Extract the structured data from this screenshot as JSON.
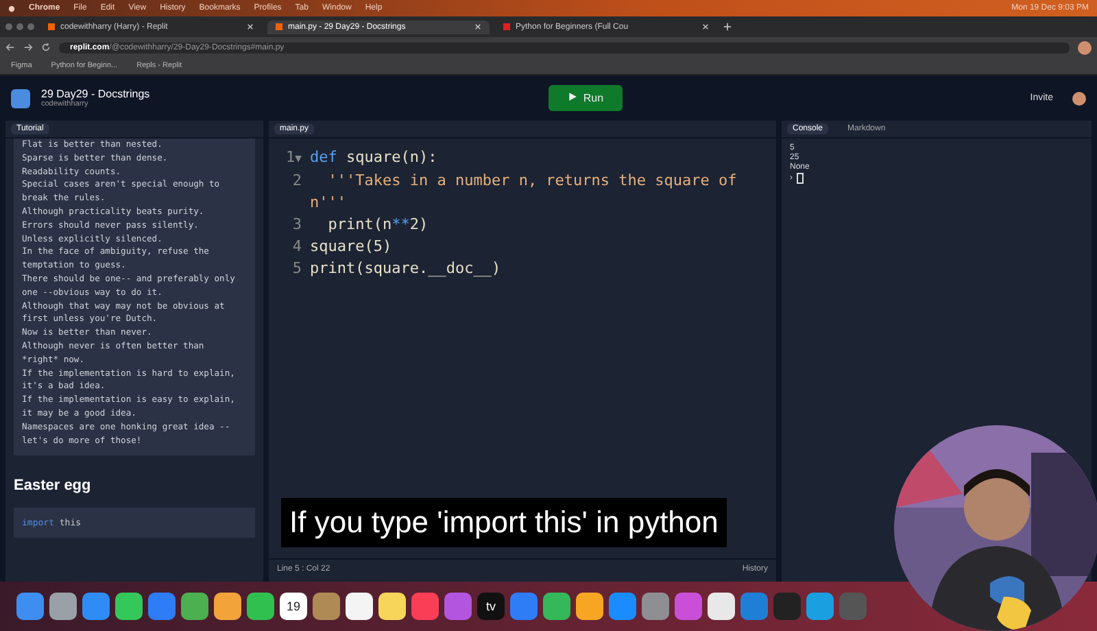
{
  "menu_bar": {
    "items": [
      "Chrome",
      "File",
      "Edit",
      "View",
      "History",
      "Bookmarks",
      "Profiles",
      "Tab",
      "Window",
      "Help"
    ],
    "clock": "Mon 19 Dec 9:03 PM"
  },
  "browser_tabs": [
    {
      "label": "codewithharry (Harry) - Replit",
      "selected": false
    },
    {
      "label": "main.py - 29 Day29 - Docstrings",
      "selected": true
    },
    {
      "label": "Python for Beginners (Full Cou",
      "selected": false
    }
  ],
  "address_bar": {
    "host": "replit.com",
    "path": "/@codewithharry/29-Day29-Docstrings#main.py"
  },
  "bookmarks": [
    "Figma",
    "Python for Beginn...",
    "Repls - Replit"
  ],
  "repl": {
    "title": "29 Day29 - Docstrings",
    "owner": "codewithharry",
    "run_label": "Run",
    "invite_label": "Invite"
  },
  "tutorial": {
    "tab": "Tutorial",
    "lines": [
      "Flat is better than nested.",
      "Sparse is better than dense.",
      "Readability counts.",
      "Special cases aren't special enough to",
      "break the rules.",
      "Although practicality beats purity.",
      "Errors should never pass silently.",
      "Unless explicitly silenced.",
      "In the face of ambiguity, refuse the",
      "temptation to guess.",
      "There should be one-- and preferably only",
      "one --obvious way to do it.",
      "Although that way may not be obvious at",
      "first unless you're Dutch.",
      "Now is better than never.",
      "Although never is often better than",
      "*right* now.",
      "If the implementation is hard to explain,",
      "it's a bad idea.",
      "If the implementation is easy to explain,",
      "it may be a good idea.",
      "Namespaces are one honking great idea --",
      "let's do more of those!"
    ],
    "heading": "Easter egg",
    "code_keyword": "import",
    "code_rest": " this"
  },
  "editor": {
    "tab": "main.py",
    "lines": [
      {
        "number": "1",
        "fold": "▼",
        "parts": [
          {
            "kind": "keyword",
            "text": "def "
          },
          {
            "kind": "name",
            "text": "square(n):"
          }
        ]
      },
      {
        "number": "2",
        "parts": [
          {
            "kind": "string",
            "text": "  '''Takes in a number n, returns the square of"
          }
        ]
      },
      {
        "parts": [
          {
            "kind": "string",
            "text": "n'''"
          }
        ]
      },
      {
        "number": "3",
        "parts": [
          {
            "kind": "name",
            "text": "  print(n"
          },
          {
            "kind": "keyword",
            "text": "**"
          },
          {
            "kind": "name",
            "text": "2)"
          }
        ]
      },
      {
        "number": "4",
        "parts": [
          {
            "kind": "name",
            "text": "square(5)"
          }
        ]
      },
      {
        "number": "5",
        "parts": [
          {
            "kind": "name",
            "text": "print(square.__doc__)"
          }
        ]
      }
    ],
    "status": "Line 5 : Col 22",
    "history": "History"
  },
  "console": {
    "tabs": [
      {
        "label": "Console",
        "selected": true
      },
      {
        "label": "Markdown",
        "selected": false
      }
    ],
    "output": [
      "5",
      "25",
      "None"
    ],
    "prompt": "›"
  },
  "subtitle": "If you type 'import this' in python",
  "dock": [
    {
      "color": "#3d8ef0"
    },
    {
      "color": "#9aa0a8"
    },
    {
      "color": "#2f8cf5"
    },
    {
      "color": "#34c759"
    },
    {
      "color": "#2e7cf6"
    },
    {
      "color": "#4caf50"
    },
    {
      "color": "#f2a33a"
    },
    {
      "color": "#30c04f"
    },
    {
      "color": "#ffffff",
      "label": "19"
    },
    {
      "color": "#b08a55"
    },
    {
      "color": "#f4f4f4"
    },
    {
      "color": "#f7d55a"
    },
    {
      "color": "#fa3e55"
    },
    {
      "color": "#b455e0"
    },
    {
      "color": "#111111",
      "label": "tv"
    },
    {
      "color": "#2e7cf6"
    },
    {
      "color": "#35b85a"
    },
    {
      "color": "#f6a623"
    },
    {
      "color": "#1a8cff"
    },
    {
      "color": "#8e8e93"
    },
    {
      "color": "#c94fd8"
    },
    {
      "color": "#e8e8e8"
    },
    {
      "color": "#1f7fd6"
    },
    {
      "color": "#222222"
    },
    {
      "color": "#1a9fe0"
    },
    {
      "color": "#555555"
    }
  ]
}
